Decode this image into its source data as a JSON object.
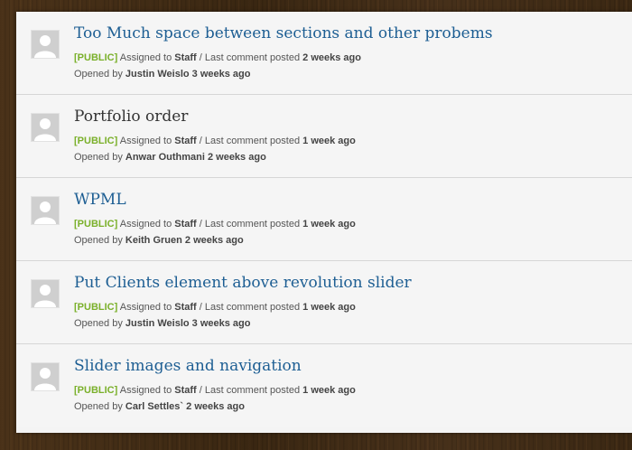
{
  "labels": {
    "assigned_to": "Assigned to",
    "separator": "/ Last comment posted",
    "opened_by": "Opened by"
  },
  "tickets": [
    {
      "title": "Too Much space between sections and other probems",
      "visibility": "[PUBLIC]",
      "assignee": "Staff",
      "last_comment": "2 weeks ago",
      "opener": "Justin Weislo",
      "opened_ago": "3 weeks ago"
    },
    {
      "title": "Portfolio order",
      "visibility": "[PUBLIC]",
      "assignee": "Staff",
      "last_comment": "1 week ago",
      "opener": "Anwar Outhmani",
      "opened_ago": "2 weeks ago"
    },
    {
      "title": "WPML",
      "visibility": "[PUBLIC]",
      "assignee": "Staff",
      "last_comment": "1 week ago",
      "opener": "Keith Gruen",
      "opened_ago": "2 weeks ago"
    },
    {
      "title": "Put Clients element above revolution slider",
      "visibility": "[PUBLIC]",
      "assignee": "Staff",
      "last_comment": "1 week ago",
      "opener": "Justin Weislo",
      "opened_ago": "3 weeks ago"
    },
    {
      "title": "Slider images and navigation",
      "visibility": "[PUBLIC]",
      "assignee": "Staff",
      "last_comment": "1 week ago",
      "opener": "Carl Settles`",
      "opened_ago": "2 weeks ago"
    }
  ],
  "colors": {
    "link": "#1d5e93",
    "visited_title": "#333333",
    "public_tag": "#7ab02a"
  },
  "icons": {
    "avatar": "default-user-avatar-icon"
  }
}
